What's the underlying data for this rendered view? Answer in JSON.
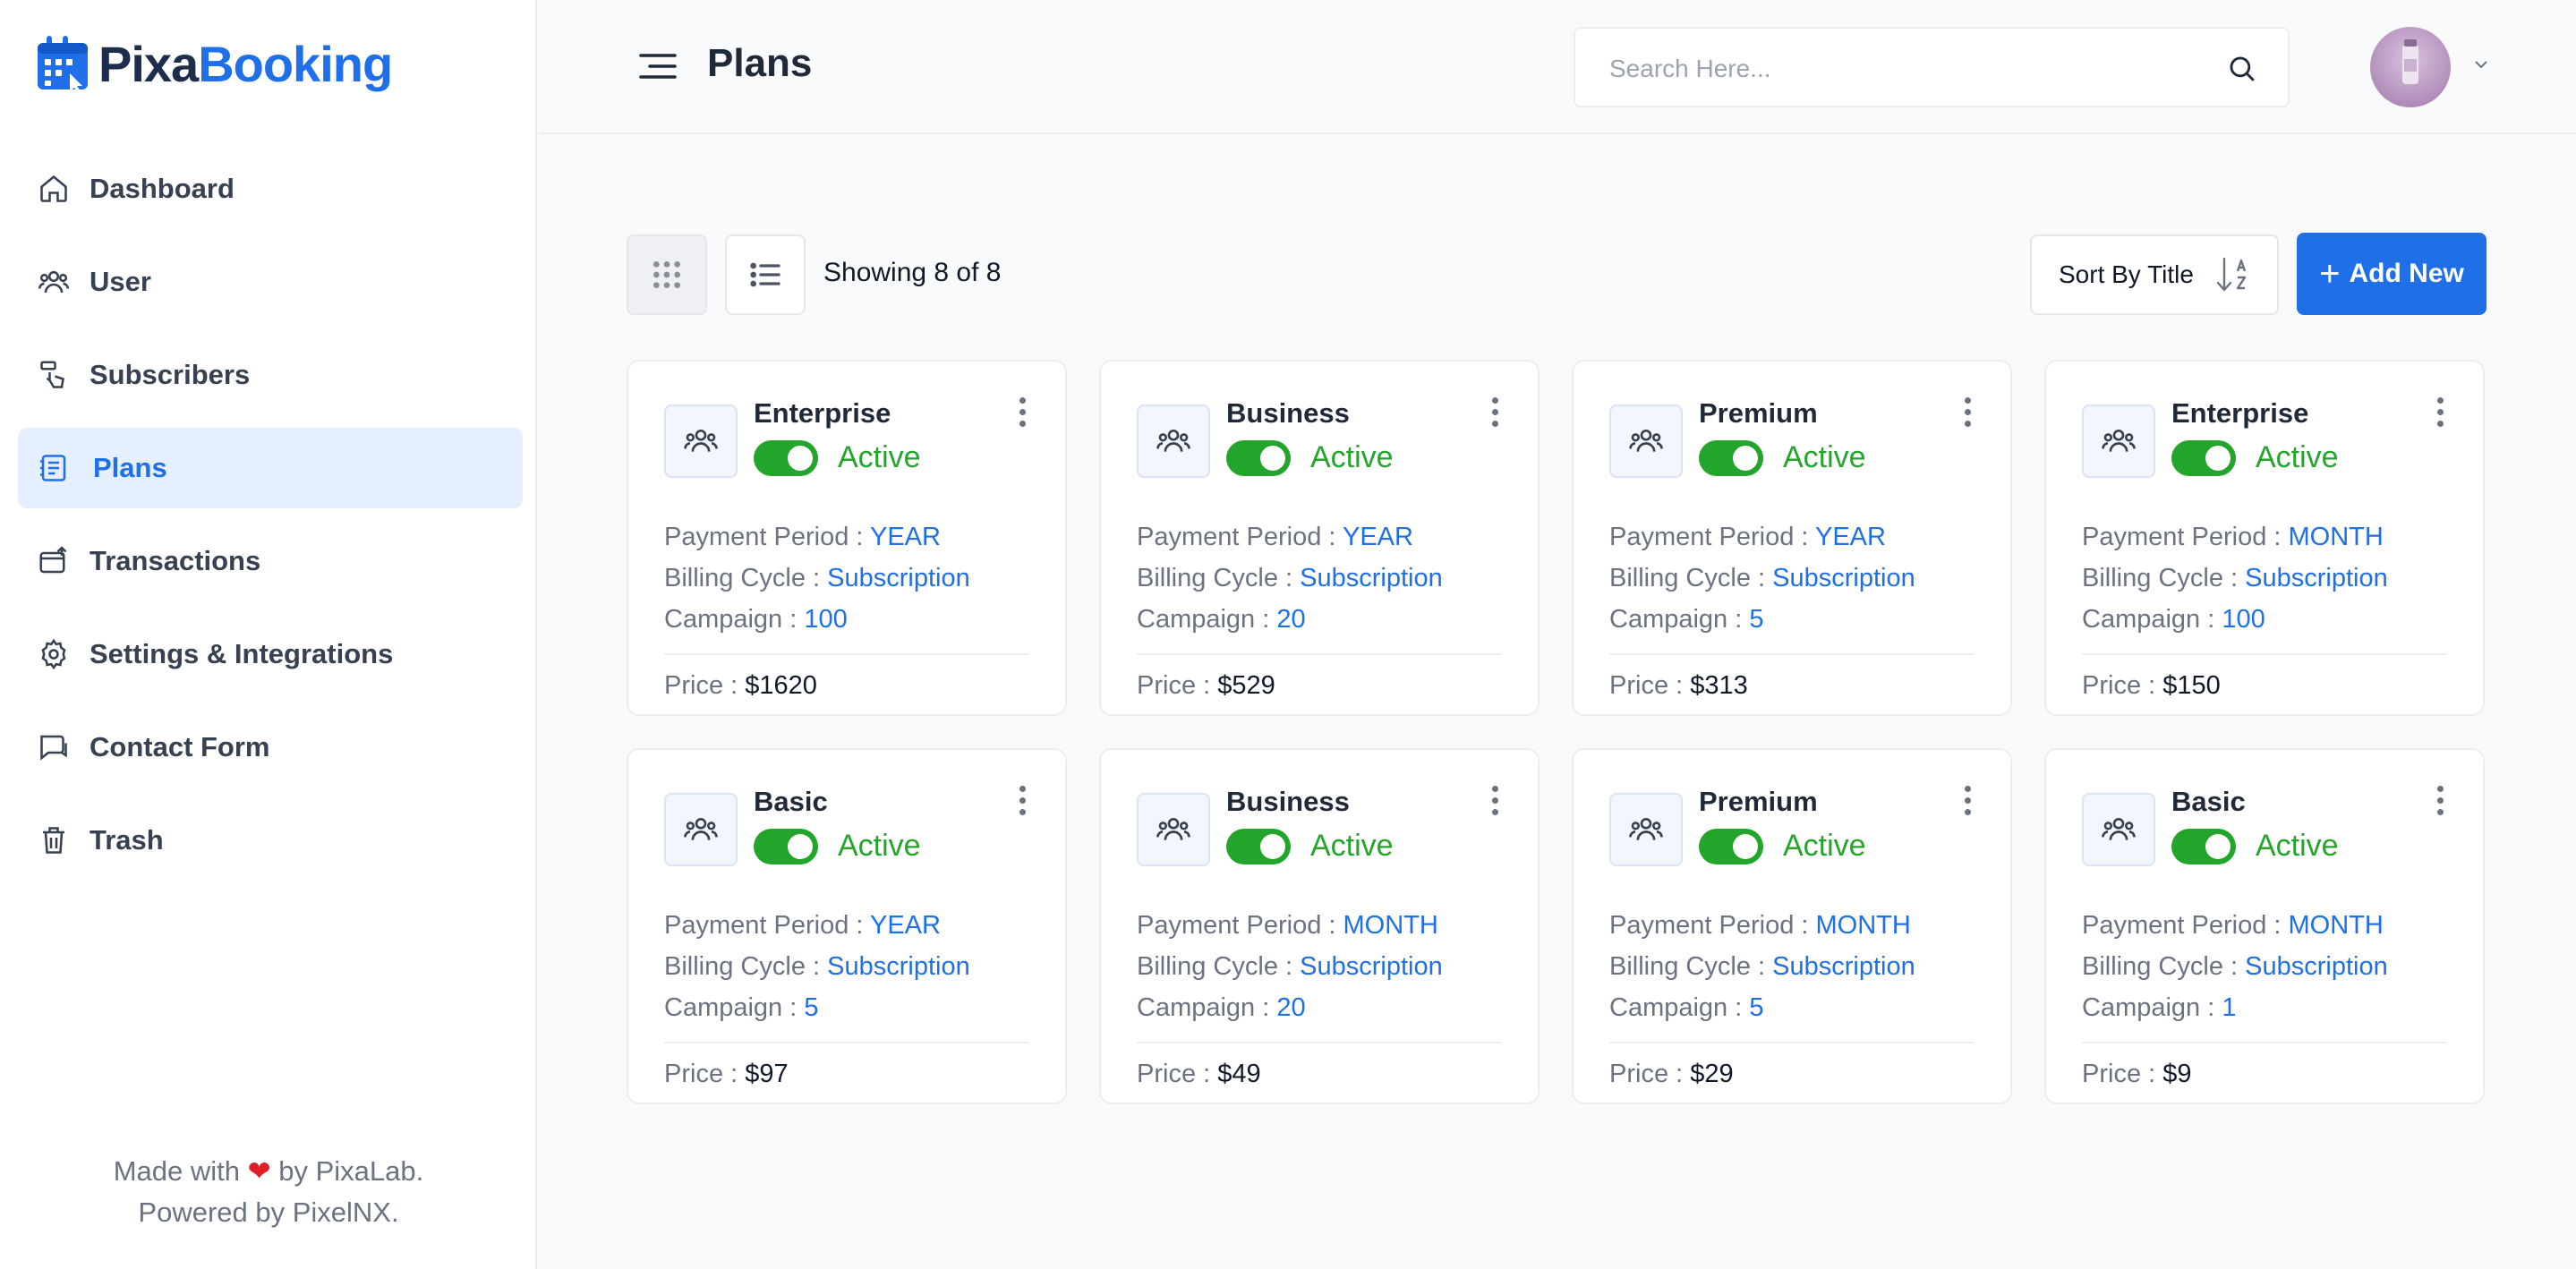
{
  "brand": {
    "name_part1": "Pixa",
    "name_part2": "Booking"
  },
  "sidebar": {
    "items": [
      {
        "label": "Dashboard",
        "icon": "home-icon"
      },
      {
        "label": "User",
        "icon": "users-icon"
      },
      {
        "label": "Subscribers",
        "icon": "subscribers-icon"
      },
      {
        "label": "Plans",
        "icon": "plans-icon",
        "active": true
      },
      {
        "label": "Transactions",
        "icon": "transactions-icon"
      },
      {
        "label": "Settings & Integrations",
        "icon": "gear-icon"
      },
      {
        "label": "Contact Form",
        "icon": "chat-icon"
      },
      {
        "label": "Trash",
        "icon": "trash-icon"
      }
    ],
    "footer": {
      "line1_pre": "Made with",
      "line1_post": "by PixaLab.",
      "line2": "Powered by PixelNX."
    }
  },
  "header": {
    "title": "Plans",
    "search_placeholder": "Search Here..."
  },
  "toolbar": {
    "showing": "Showing 8 of 8",
    "sort_label": "Sort By Title",
    "add_label": "Add New"
  },
  "labels": {
    "payment_period": "Payment Period : ",
    "billing_cycle": "Billing Cycle : ",
    "campaign": "Campaign : ",
    "price": "Price : "
  },
  "plans": [
    {
      "title": "Enterprise",
      "status": "Active",
      "payment_period": "YEAR",
      "billing_cycle": "Subscription",
      "campaign": "100",
      "price": "$1620"
    },
    {
      "title": "Business",
      "status": "Active",
      "payment_period": "YEAR",
      "billing_cycle": "Subscription",
      "campaign": "20",
      "price": "$529"
    },
    {
      "title": "Premium",
      "status": "Active",
      "payment_period": "YEAR",
      "billing_cycle": "Subscription",
      "campaign": "5",
      "price": "$313"
    },
    {
      "title": "Enterprise",
      "status": "Active",
      "payment_period": "MONTH",
      "billing_cycle": "Subscription",
      "campaign": "100",
      "price": "$150"
    },
    {
      "title": "Basic",
      "status": "Active",
      "payment_period": "YEAR",
      "billing_cycle": "Subscription",
      "campaign": "5",
      "price": "$97"
    },
    {
      "title": "Business",
      "status": "Active",
      "payment_period": "MONTH",
      "billing_cycle": "Subscription",
      "campaign": "20",
      "price": "$49"
    },
    {
      "title": "Premium",
      "status": "Active",
      "payment_period": "MONTH",
      "billing_cycle": "Subscription",
      "campaign": "5",
      "price": "$29"
    },
    {
      "title": "Basic",
      "status": "Active",
      "payment_period": "MONTH",
      "billing_cycle": "Subscription",
      "campaign": "1",
      "price": "$9"
    }
  ],
  "colors": {
    "accent": "#1e6fe8",
    "active": "#22a52a",
    "brand_dark": "#1f2d4d"
  }
}
